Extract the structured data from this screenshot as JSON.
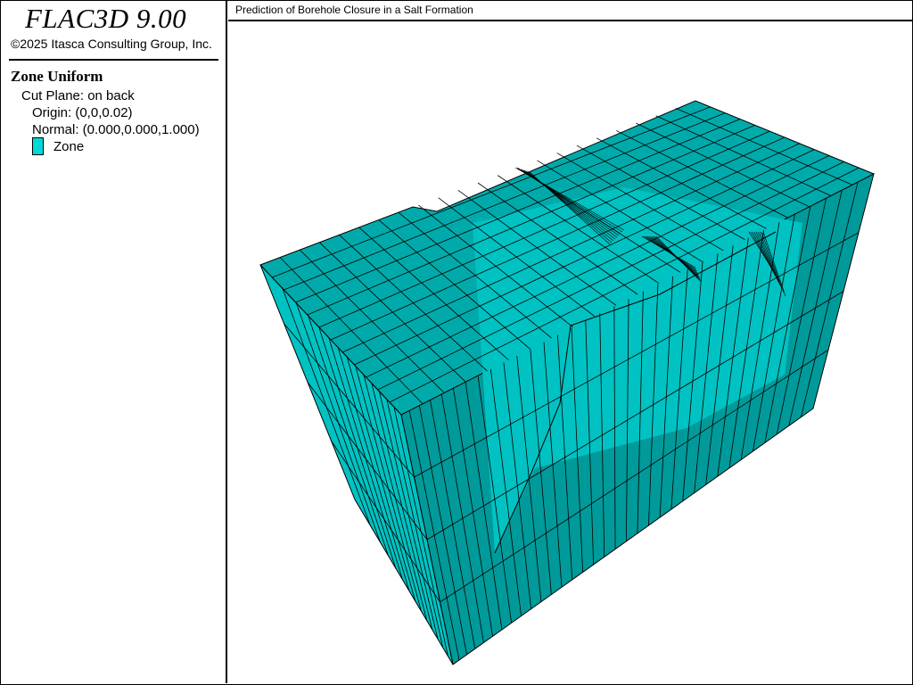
{
  "app": {
    "title": "FLAC3D 9.00",
    "copyright": "©2025 Itasca Consulting Group, Inc."
  },
  "legend": {
    "heading": "Zone Uniform",
    "cut_plane": "Cut Plane: on back",
    "origin": "Origin: (0,0,0.02)",
    "normal": "Normal: (0.000,0.000,1.000)",
    "zone_label": "Zone",
    "zone_color": "#00d8d8"
  },
  "view": {
    "title": "Prediction of Borehole Closure in a Salt Formation",
    "top_color": "#00aaaa",
    "front_color": "#00c2c2",
    "side_color": "#009a9a",
    "line_color": "#000000"
  }
}
